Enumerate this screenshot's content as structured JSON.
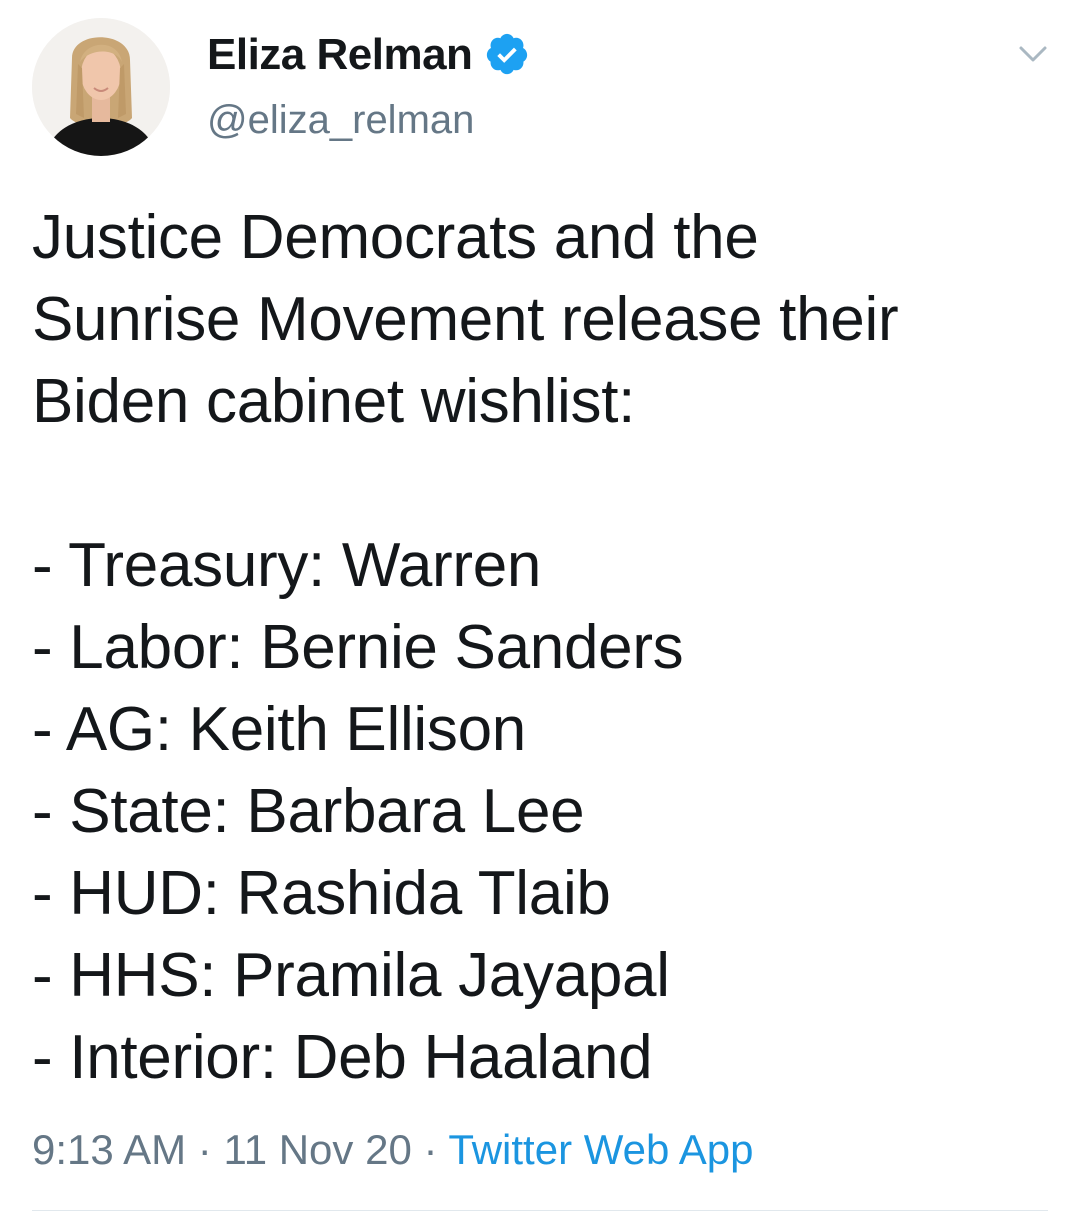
{
  "tweet": {
    "author": {
      "display_name": "Eliza Relman",
      "handle": "@eliza_relman",
      "verified": true,
      "avatar_icon": "profile-photo"
    },
    "text": "Justice Democrats and the\nSunrise Movement release their\nBiden cabinet wishlist:\n\n- Treasury: Warren\n- Labor: Bernie Sanders\n- AG: Keith Ellison\n- State: Barbara Lee\n- HUD: Rashida Tlaib\n- HHS: Pramila Jayapal\n- Interior: Deb Haaland",
    "time": "9:13 AM",
    "separator": "·",
    "date": "11 Nov 20",
    "source": "Twitter Web App"
  },
  "colors": {
    "text": "#14171a",
    "secondary": "#657786",
    "link": "#1b95e0",
    "verified": "#1da1f2",
    "divider": "#e1e8ed"
  }
}
